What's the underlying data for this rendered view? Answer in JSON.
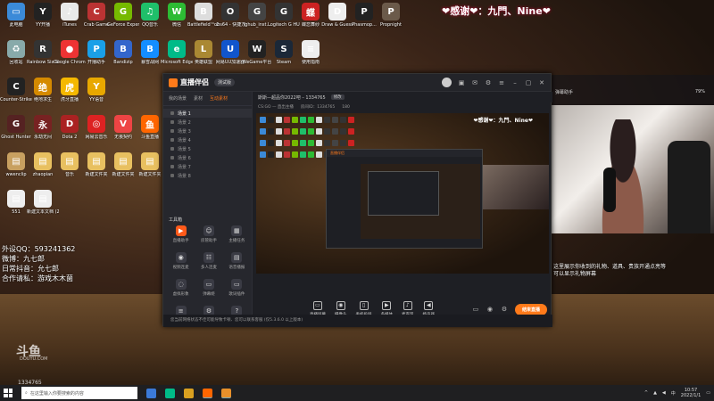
{
  "banner": {
    "thanks": "❤感谢❤：九門、Nine❤"
  },
  "desktop_icons": [
    {
      "label": "此电脑",
      "glyph": "▭",
      "color": "#3b8ad8"
    },
    {
      "label": "YY开播",
      "glyph": "Y",
      "color": "#222"
    },
    {
      "label": "iTunes",
      "glyph": "♪",
      "color": "#e9e9e9"
    },
    {
      "label": "Crab Game",
      "glyph": "C",
      "color": "#b33"
    },
    {
      "label": "GeForce Experience",
      "glyph": "G",
      "color": "#76b900"
    },
    {
      "label": "QQ音乐",
      "glyph": "♫",
      "color": "#1fbf6a"
    },
    {
      "label": "微信",
      "glyph": "W",
      "color": "#2dbb34"
    },
    {
      "label": "Battlefield™ 2042 Ope...",
      "glyph": "B",
      "color": "#ddd"
    },
    {
      "label": "obs64 - 快捷方式",
      "glyph": "O",
      "color": "#333"
    },
    {
      "label": "lghub_inst...",
      "glyph": "G",
      "color": "#444"
    },
    {
      "label": "Logitech G HUB",
      "glyph": "G",
      "color": "#333"
    },
    {
      "label": "蝶恋舞纱",
      "glyph": "蝶",
      "color": "#c22"
    },
    {
      "label": "Draw & Guess",
      "glyph": "D",
      "color": "#eee"
    },
    {
      "label": "Phasmop...",
      "glyph": "P",
      "color": "#222"
    },
    {
      "label": "Propnight",
      "glyph": "P",
      "color": "#6b5a4a"
    },
    {
      "label": "回收站",
      "glyph": "♻",
      "color": "#8aa"
    },
    {
      "label": "Rainbow Six Siege",
      "glyph": "R",
      "color": "#333"
    },
    {
      "label": "Google Chrome",
      "glyph": "●",
      "color": "#e33"
    },
    {
      "label": "开播助手",
      "glyph": "P",
      "color": "#1aa0e8"
    },
    {
      "label": "Bandizip",
      "glyph": "B",
      "color": "#36c"
    },
    {
      "label": "暴雪战网",
      "glyph": "B",
      "color": "#148eff"
    },
    {
      "label": "Microsoft Edge",
      "glyph": "e",
      "color": "#0b8"
    },
    {
      "label": "英雄联盟",
      "glyph": "L",
      "color": "#a83"
    },
    {
      "label": "网易UU加速器",
      "glyph": "U",
      "color": "#15c"
    },
    {
      "label": "WeGame平台",
      "glyph": "W",
      "color": "#222"
    },
    {
      "label": "Steam",
      "glyph": "S",
      "color": "#1b2838"
    },
    {
      "label": "使用指南",
      "glyph": "≡",
      "color": "#eee"
    },
    {
      "label": "Counter-Strike: Global Off...",
      "glyph": "C",
      "color": "#222"
    },
    {
      "label": "绝地求生",
      "glyph": "绝",
      "color": "#d58a00"
    },
    {
      "label": "虎牙直播",
      "glyph": "虎",
      "color": "#f5b800"
    },
    {
      "label": "YY语音",
      "glyph": "Y",
      "color": "#e8a800"
    },
    {
      "label": "Ghost Hunter",
      "glyph": "G",
      "color": "#522"
    },
    {
      "label": "永劫无间",
      "glyph": "永",
      "color": "#722"
    },
    {
      "label": "Dota 2",
      "glyph": "D",
      "color": "#a22"
    },
    {
      "label": "网易云音乐",
      "glyph": "◎",
      "color": "#d22"
    },
    {
      "label": "无畏契约",
      "glyph": "V",
      "color": "#e44"
    },
    {
      "label": "斗鱼直播",
      "glyph": "鱼",
      "color": "#f60"
    },
    {
      "label": "wwenclip",
      "glyph": "▤",
      "color": "#c8a060"
    },
    {
      "label": "zhaopian",
      "glyph": "▤",
      "color": "#e8c060"
    },
    {
      "label": "音乐",
      "glyph": "▤",
      "color": "#e8c060"
    },
    {
      "label": "新建文件夹",
      "glyph": "▤",
      "color": "#e8c060"
    },
    {
      "label": "新建文件夹",
      "glyph": "▤",
      "color": "#e8c060"
    },
    {
      "label": "新建文件夹",
      "glyph": "▤",
      "color": "#e8c060"
    },
    {
      "label": "551",
      "glyph": "▤",
      "color": "#eee"
    },
    {
      "label": "新建文本文档 (2)",
      "glyph": "▤",
      "color": "#eee"
    }
  ],
  "info": {
    "line1": "外设QQ：593241362",
    "line2": "微博：九七郎",
    "line3": "日常抖音：允七郎",
    "line4": "合作请私：游戏木木菌"
  },
  "douyu": {
    "logo": "斗鱼",
    "sub": "DOUYU.COM",
    "id": "1334765"
  },
  "app": {
    "title": "直播伴侣",
    "badge": "测试版",
    "left_tabs": [
      "我的场景",
      "素材",
      "互动素材"
    ],
    "scenes": [
      "场景 1",
      "场景 2",
      "场景 3",
      "场景 4",
      "场景 5",
      "场景 6",
      "场景 7",
      "场景 8"
    ],
    "toolbox_title": "工具箱",
    "tools": [
      {
        "label": "直播助手",
        "glyph": "▶",
        "hot": true
      },
      {
        "label": "房管助手",
        "glyph": "☺",
        "hot": false
      },
      {
        "label": "主播任务",
        "glyph": "▦",
        "hot": false
      },
      {
        "label": "视频连麦",
        "glyph": "◉",
        "hot": false
      },
      {
        "label": "多人连麦",
        "glyph": "☷",
        "hot": false
      },
      {
        "label": "语音播报",
        "glyph": "▤",
        "hot": false
      },
      {
        "label": "虚拟形象",
        "glyph": "◌",
        "hot": false
      },
      {
        "label": "弹幕姬",
        "glyph": "▭",
        "hot": false
      },
      {
        "label": "歌词插件",
        "glyph": "▭",
        "hot": false
      },
      {
        "label": "更多",
        "glyph": "≡",
        "hot": false
      },
      {
        "label": "设置",
        "glyph": "⚙",
        "hot": false
      },
      {
        "label": "帮助",
        "glyph": "?",
        "hot": false
      }
    ],
    "room": {
      "name": "斯斯—超品你2022吧 – 1334765",
      "tag": "修改",
      "category": "CS:GO — 直出主播",
      "room_label": "房间ID：1334765",
      "viewers": "180"
    },
    "preview_thanks": "❤感谢❤：九門、Nine❤",
    "nested_title": "直播伴侣",
    "actions": [
      {
        "label": "直播屏幕",
        "glyph": "▭"
      },
      {
        "label": "摄像头",
        "glyph": "◉"
      },
      {
        "label": "手机投屏",
        "glyph": "▯"
      },
      {
        "label": "多媒体",
        "glyph": "▶"
      },
      {
        "label": "麦克风",
        "glyph": "♪"
      },
      {
        "label": "扬声器",
        "glyph": "◀"
      }
    ],
    "start_button": "结束直播",
    "status": "您当前网络状态不佳可能导致卡顿、您可以联系客服 (仅5.3.6.0 以上版本)"
  },
  "right_panel": {
    "left_text": "弹幕助手",
    "right_text": "79%"
  },
  "gift_notice": "这里展示你收到的礼物、道具、贵族开通点亮等可以显示礼物屏幕",
  "taskbar": {
    "search_placeholder": "在这里输入你要搜索的内容",
    "time": "10:57",
    "date": "2022/1/1",
    "lang": "中"
  }
}
